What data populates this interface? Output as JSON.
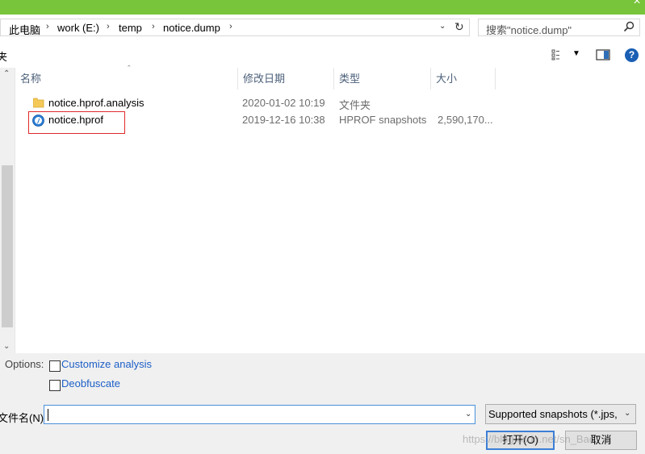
{
  "window": {
    "close_glyph": "×"
  },
  "address": {
    "crumbs": [
      "此电脑",
      "work (E:)",
      "temp",
      "notice.dump"
    ],
    "separator": "›"
  },
  "search": {
    "placeholder": "搜索\"notice.dump\""
  },
  "toolbar": {
    "cut_label": "夹"
  },
  "columns": {
    "name": "名称",
    "modified": "修改日期",
    "type": "类型",
    "size": "大小"
  },
  "files": [
    {
      "name": "notice.hprof.analysis",
      "modified": "2020-01-02 10:19",
      "type": "文件夹",
      "size": "",
      "icon": "folder-icon"
    },
    {
      "name": "notice.hprof",
      "modified": "2019-12-16 10:38",
      "type": "HPROF snapshots",
      "size": "2,590,170...",
      "icon": "hprof-file-icon"
    }
  ],
  "options": {
    "label": "Options:",
    "customize": "Customize analysis",
    "deobfuscate": "Deobfuscate"
  },
  "filename": {
    "label": "文件名(N):",
    "value": ""
  },
  "filter": {
    "selected": "Supported snapshots (*.jps,"
  },
  "buttons": {
    "open": "打开(O)",
    "cancel": "取消"
  },
  "watermark": "https://blog.csdn.net/sn_Bac",
  "colors": {
    "titlebar": "#78c43a",
    "highlight": "#e0292b",
    "link": "#1d5fc7",
    "help": "#1a5fb4"
  }
}
